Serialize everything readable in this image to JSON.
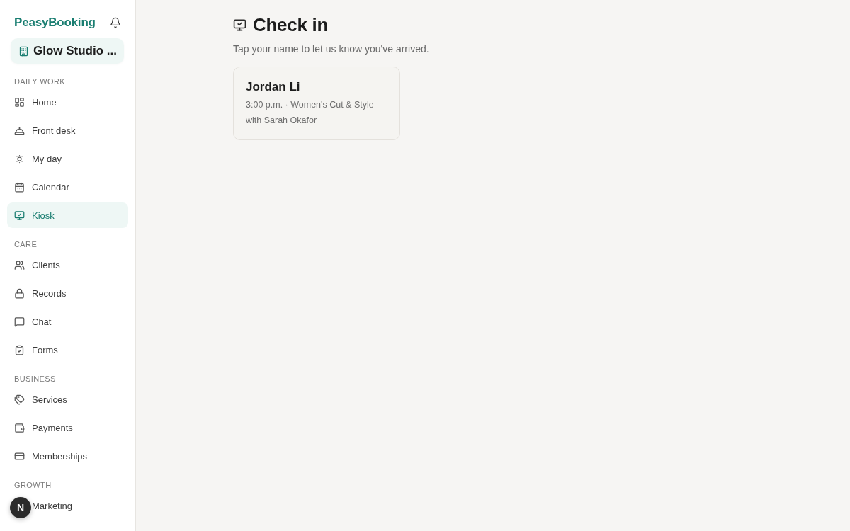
{
  "sidebar": {
    "logo": "PeasyBooking",
    "studio": {
      "label": "Glow Studio ..."
    },
    "sections": [
      {
        "heading": "DAILY WORK",
        "items": [
          {
            "label": "Home",
            "selected": false
          },
          {
            "label": "Front desk",
            "selected": false
          },
          {
            "label": "My day",
            "selected": false
          },
          {
            "label": "Calendar",
            "selected": false
          },
          {
            "label": "Kiosk",
            "selected": true
          }
        ]
      },
      {
        "heading": "CARE",
        "items": [
          {
            "label": "Clients",
            "selected": false
          },
          {
            "label": "Records",
            "selected": false
          },
          {
            "label": "Chat",
            "selected": false
          },
          {
            "label": "Forms",
            "selected": false
          }
        ]
      },
      {
        "heading": "BUSINESS",
        "items": [
          {
            "label": "Services",
            "selected": false
          },
          {
            "label": "Payments",
            "selected": false
          },
          {
            "label": "Memberships",
            "selected": false
          }
        ]
      },
      {
        "heading": "GROWTH",
        "items": [
          {
            "label": "Marketing",
            "selected": false
          }
        ]
      }
    ]
  },
  "page": {
    "title": "Check in",
    "subtitle": "Tap your name to let us know you've arrived.",
    "appointments": [
      {
        "name": "Jordan Li",
        "details": "3:00 p.m. · Women's Cut & Style",
        "staff": "with Sarah Okafor"
      }
    ]
  },
  "dev_badge": {
    "label": "N"
  }
}
